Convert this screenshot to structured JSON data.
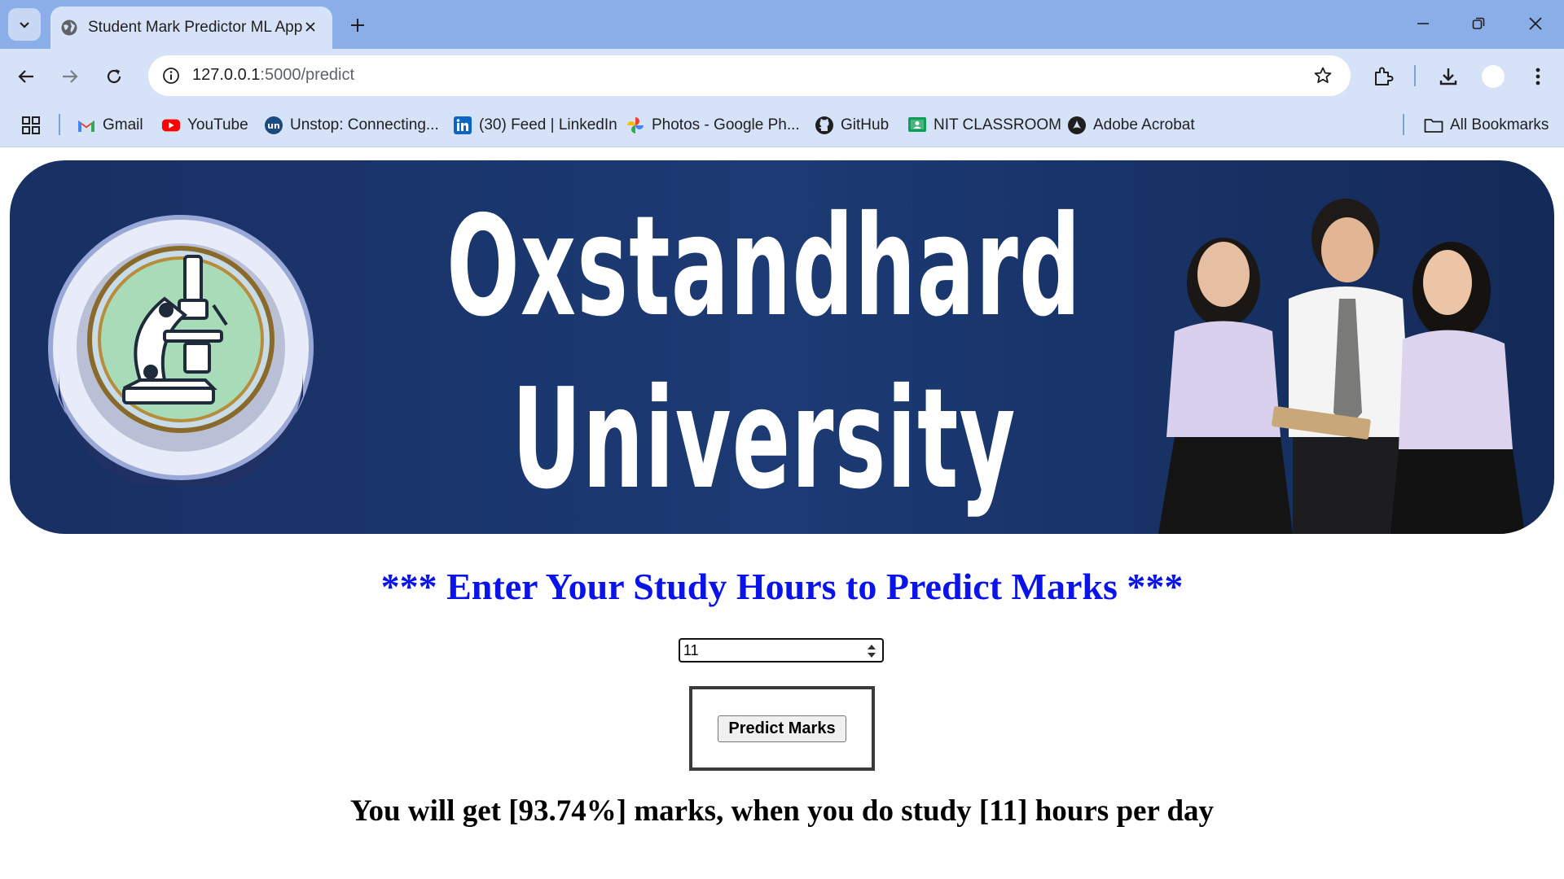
{
  "browser": {
    "tab_title": "Student Mark Predictor ML App",
    "url_host": "127.0.0.1",
    "url_path": ":5000/predict",
    "bookmarks": [
      {
        "label": "Gmail",
        "icon": "gmail-icon"
      },
      {
        "label": "YouTube",
        "icon": "youtube-icon"
      },
      {
        "label": "Unstop: Connecting...",
        "icon": "unstop-icon"
      },
      {
        "label": "(30) Feed | LinkedIn",
        "icon": "linkedin-icon"
      },
      {
        "label": "Photos - Google Ph...",
        "icon": "google-photos-icon"
      },
      {
        "label": "GitHub",
        "icon": "github-icon"
      },
      {
        "label": "NIT CLASSROOM",
        "icon": "classroom-icon"
      },
      {
        "label": "Adobe Acrobat",
        "icon": "acrobat-icon"
      }
    ],
    "all_bookmarks": "All Bookmarks"
  },
  "banner": {
    "line1": "Oxstandhard",
    "line2": "University"
  },
  "form": {
    "heading": "*** Enter Your Study Hours to Predict Marks ***",
    "hours_value": "11",
    "button_label": "Predict Marks"
  },
  "result": {
    "text": "You will get [93.74%] marks, when you do study [11] hours per day"
  },
  "colors": {
    "heading": "#0a13e8",
    "banner_bg": "#1c3a74",
    "tabstrip": "#8aaee8",
    "toolbar": "#d6e2f8"
  }
}
